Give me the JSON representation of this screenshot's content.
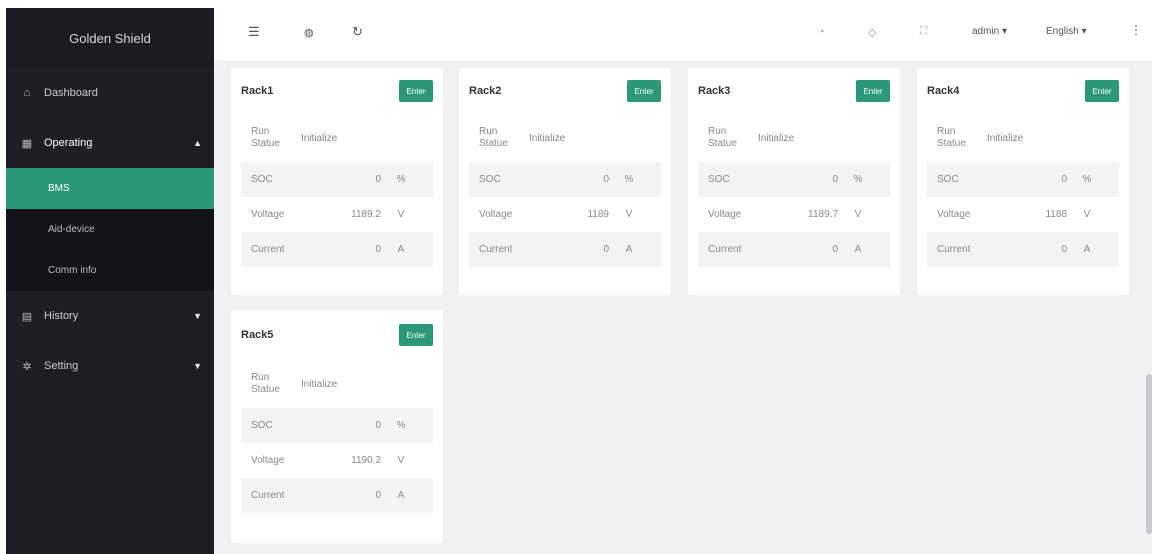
{
  "app": {
    "title": "Golden Shield"
  },
  "sidebar": {
    "items": [
      {
        "label": "Dashboard",
        "icon": "home-icon"
      },
      {
        "label": "Operating",
        "icon": "grid-icon",
        "children": [
          {
            "label": "BMS"
          },
          {
            "label": "Aid-device"
          },
          {
            "label": "Comm info"
          }
        ]
      },
      {
        "label": "History",
        "icon": "calendar-icon"
      },
      {
        "label": "Setting",
        "icon": "gear-icon"
      }
    ]
  },
  "header": {
    "user": "admin",
    "language": "English"
  },
  "colors": {
    "accent": "#2a9879",
    "sidebar": "#1d1f25"
  },
  "racks": [
    {
      "title": "Rack1",
      "enter": "Enter",
      "run_label": "Run Statue",
      "run_status": "Initialize",
      "soc": {
        "label": "SOC",
        "value": "0",
        "unit": "%"
      },
      "voltage": {
        "label": "Voltage",
        "value": "1189.2",
        "unit": "V"
      },
      "current": {
        "label": "Current",
        "value": "0",
        "unit": "A"
      }
    },
    {
      "title": "Rack2",
      "enter": "Enter",
      "run_label": "Run Statue",
      "run_status": "Initialize",
      "soc": {
        "label": "SOC",
        "value": "0",
        "unit": "%"
      },
      "voltage": {
        "label": "Voltage",
        "value": "1189",
        "unit": "V"
      },
      "current": {
        "label": "Current",
        "value": "0",
        "unit": "A"
      }
    },
    {
      "title": "Rack3",
      "enter": "Enter",
      "run_label": "Run Statue",
      "run_status": "Initialize",
      "soc": {
        "label": "SOC",
        "value": "0",
        "unit": "%"
      },
      "voltage": {
        "label": "Voltage",
        "value": "1189.7",
        "unit": "V"
      },
      "current": {
        "label": "Current",
        "value": "0",
        "unit": "A"
      }
    },
    {
      "title": "Rack4",
      "enter": "Enter",
      "run_label": "Run Statue",
      "run_status": "Initialize",
      "soc": {
        "label": "SOC",
        "value": "0",
        "unit": "%"
      },
      "voltage": {
        "label": "Voltage",
        "value": "1188",
        "unit": "V"
      },
      "current": {
        "label": "Current",
        "value": "0",
        "unit": "A"
      }
    },
    {
      "title": "Rack5",
      "enter": "Enter",
      "run_label": "Run Statue",
      "run_status": "Initialize",
      "soc": {
        "label": "SOC",
        "value": "0",
        "unit": "%"
      },
      "voltage": {
        "label": "Voltage",
        "value": "1190.2",
        "unit": "V"
      },
      "current": {
        "label": "Current",
        "value": "0",
        "unit": "A"
      }
    }
  ]
}
